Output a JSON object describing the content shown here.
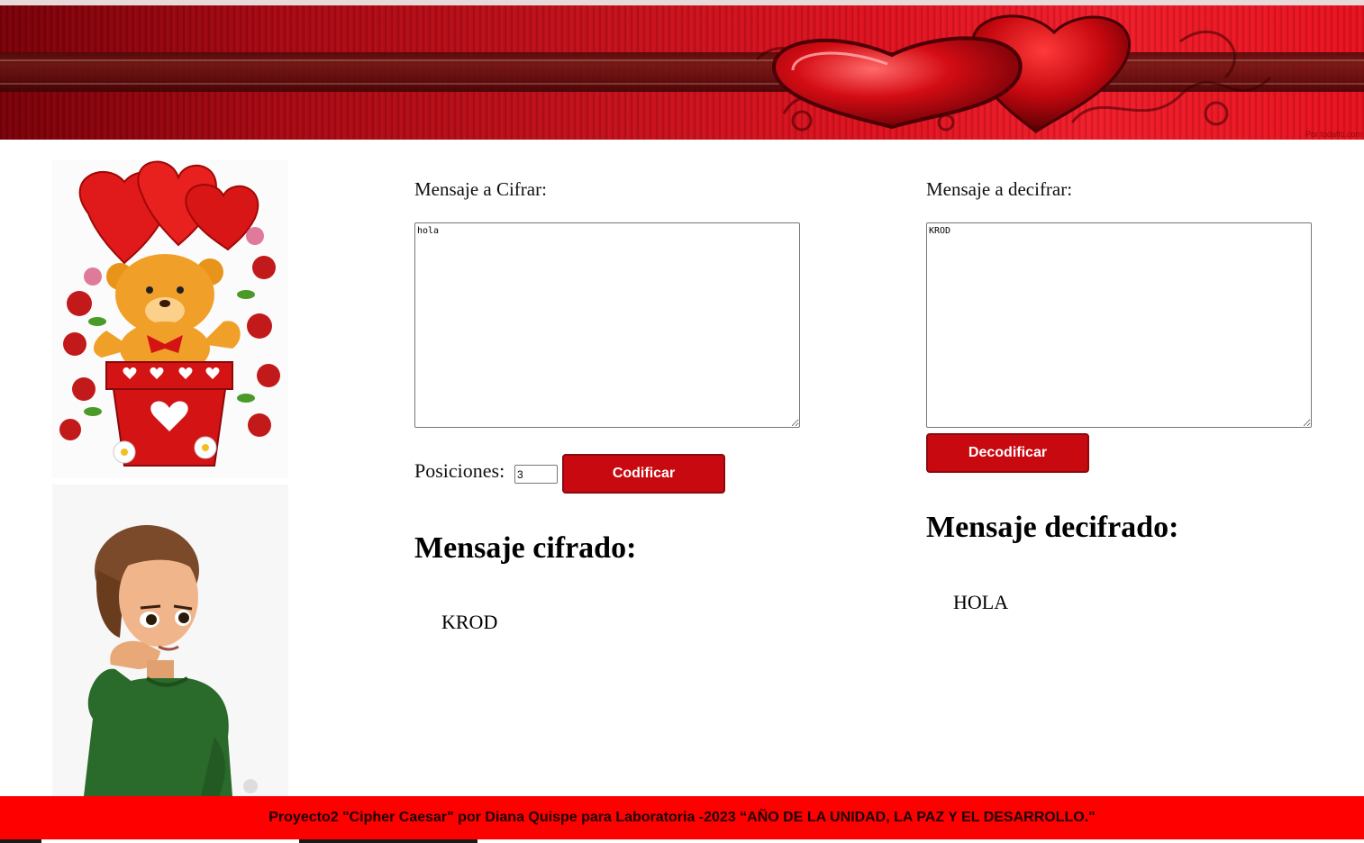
{
  "header": {
    "banner_credit": "Por todaflo.com"
  },
  "left_images": [
    {
      "icon": "teddy-bear-hearts-image"
    },
    {
      "icon": "animated-girl-thinking-image"
    }
  ],
  "encrypt": {
    "label": "Mensaje a Cifrar:",
    "input_value": "hola",
    "positions_label": "Posiciones:",
    "positions_value": "3",
    "button_label": "Codificar",
    "result_heading": "Mensaje cifrado:",
    "result_value": "KROD"
  },
  "decrypt": {
    "label": "Mensaje a decifrar:",
    "input_value": "KROD",
    "button_label": "Decodificar",
    "result_heading": "Mensaje decifrado:",
    "result_value": "HOLA"
  },
  "footer": {
    "text": "Proyecto2 \"Cipher Caesar\" por Diana Quispe para Laboratoria -2023 “AÑO DE LA UNIDAD, LA PAZ Y EL DESARROLLO.\""
  },
  "colors": {
    "button_bg": "#c8090f",
    "footer_bg": "#fe0000",
    "banner_red": "#e0121f"
  }
}
